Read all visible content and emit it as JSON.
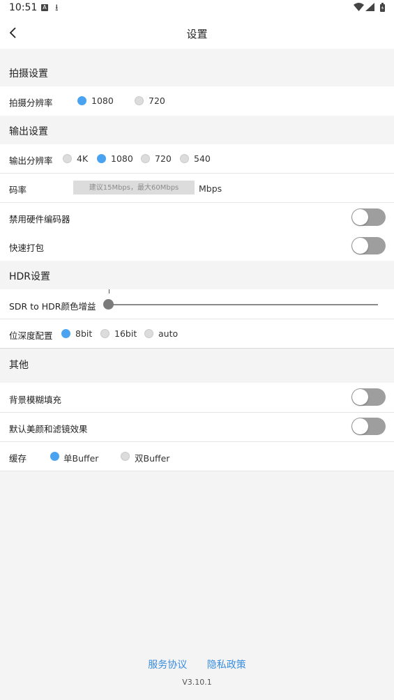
{
  "status_bar": {
    "time": "10:51",
    "a_badge": "A",
    "download_glyph": "⭳",
    "icons": [
      "a-badge-icon",
      "download-icon",
      "wifi-icon",
      "cell-signal-icon",
      "battery-icon"
    ]
  },
  "header": {
    "title": "设置",
    "back_icon": "chevron-left-icon"
  },
  "capture": {
    "section_title": "拍摄设置",
    "resolution_label": "拍摄分辨率",
    "options": [
      "1080",
      "720"
    ],
    "selected": "1080"
  },
  "output": {
    "section_title": "输出设置",
    "resolution_label": "输出分辨率",
    "options": [
      "4K",
      "1080",
      "720",
      "540"
    ],
    "selected": "1080",
    "bitrate_label": "码率",
    "bitrate_placeholder": "建议15Mbps，最大60Mbps",
    "bitrate_value": "",
    "bitrate_unit": "Mbps",
    "disable_hw_encoder_label": "禁用硬件编码器",
    "disable_hw_encoder_on": false,
    "fast_pack_label": "快速打包",
    "fast_pack_on": false
  },
  "hdr": {
    "section_title": "HDR设置",
    "color_gain_label": "SDR to HDR颜色增益",
    "color_gain_level": 0,
    "bit_depth_label": "位深度配置",
    "bit_depth_options": [
      "8bit",
      "16bit",
      "auto"
    ],
    "bit_depth_selected": "8bit"
  },
  "other": {
    "section_title": "其他",
    "bg_blur_label": "背景模糊填充",
    "bg_blur_on": false,
    "beauty_filter_label": "默认美颜和滤镜效果",
    "beauty_filter_on": false,
    "cache_label": "缓存",
    "cache_options": [
      "单Buffer",
      "双Buffer"
    ],
    "cache_selected": "单Buffer"
  },
  "footer": {
    "terms_link": "服务协议",
    "privacy_link": "隐私政策",
    "version": "V3.10.1"
  },
  "colors": {
    "accent": "#4aa3f0",
    "link": "#3a8de0",
    "toggle_off": "#9e9e9e",
    "background": "#f4f4f4"
  }
}
